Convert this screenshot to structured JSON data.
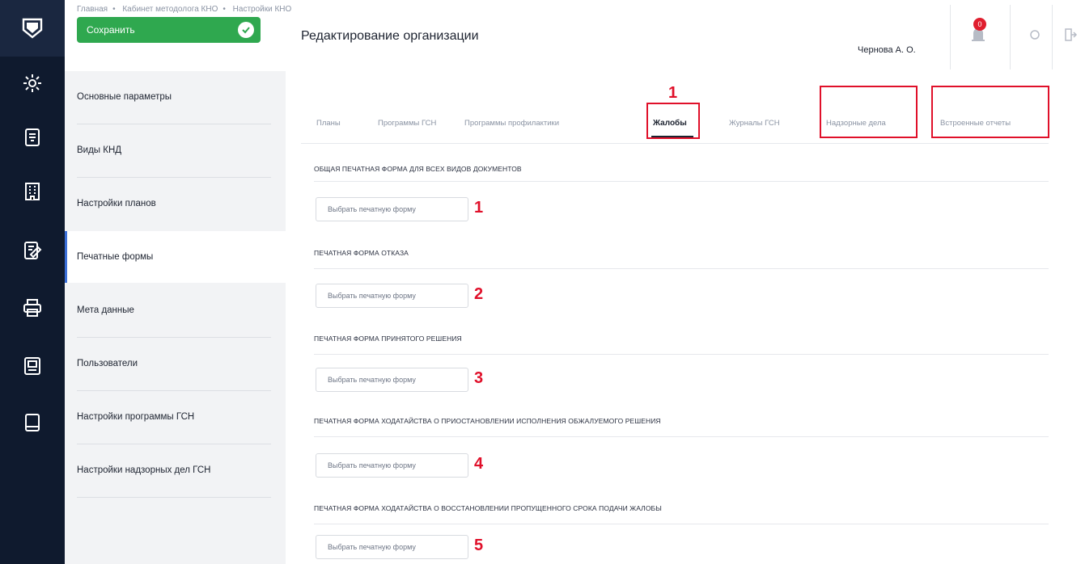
{
  "breadcrumb": [
    "Главная",
    "Кабинет методолога КНО",
    "Настройки КНО"
  ],
  "toolbar": {
    "save_label": "Сохранить"
  },
  "page_title": "Редактирование организации",
  "user": {
    "name": "Чернова А. О."
  },
  "notifications": {
    "count": "0"
  },
  "rail_icons": [
    "logo-icon",
    "gear-icon",
    "document-icon",
    "building-icon",
    "edit-document-icon",
    "printer-icon",
    "report-icon",
    "book-icon"
  ],
  "menu": {
    "items": [
      {
        "label": "Основные параметры"
      },
      {
        "label": "Виды КНД"
      },
      {
        "label": "Настройки планов"
      },
      {
        "label": "Печатные формы"
      },
      {
        "label": "Мета данные"
      },
      {
        "label": "Пользователи"
      },
      {
        "label": "Настройки программы ГСН"
      },
      {
        "label": "Настройки надзорных дел ГСН"
      }
    ],
    "active_index": 3
  },
  "tabs": [
    {
      "label": "Планы"
    },
    {
      "label": "Программы ГСН"
    },
    {
      "label": "Программы профилактики"
    },
    {
      "label": "Жалобы"
    },
    {
      "label": "Журналы ГСН"
    },
    {
      "label": "Надзорные дела"
    },
    {
      "label": "Встроенные отчеты"
    }
  ],
  "active_tab": 3,
  "sections": [
    {
      "title": "ОБЩАЯ ПЕЧАТНАЯ ФОРМА ДЛЯ ВСЕХ ВИДОВ ДОКУМЕНТОВ",
      "button": "Выбрать печатную форму",
      "marker": "1"
    },
    {
      "title": "ПЕЧАТНАЯ ФОРМА ОТКАЗА",
      "button": "Выбрать печатную форму",
      "marker": "2"
    },
    {
      "title": "ПЕЧАТНАЯ ФОРМА ПРИНЯТОГО РЕШЕНИЯ",
      "button": "Выбрать печатную форму",
      "marker": "3"
    },
    {
      "title": "ПЕЧАТНАЯ ФОРМА ХОДАТАЙСТВА О ПРИОСТАНОВЛЕНИИ ИСПОЛНЕНИЯ ОБЖАЛУЕМОГО РЕШЕНИЯ",
      "button": "Выбрать печатную форму",
      "marker": "4"
    },
    {
      "title": "ПЕЧАТНАЯ ФОРМА ХОДАТАЙСТВА О ВОССТАНОВЛЕНИИ ПРОПУЩЕННОГО СРОКА ПОДАЧИ ЖАЛОБЫ",
      "button": "Выбрать печатную форму",
      "marker": "5"
    }
  ],
  "annotations": {
    "tab_marker": "1",
    "highlight_color": "#e0102a"
  },
  "colors": {
    "rail": "#0f1a2e",
    "accent_green": "#2fa84f",
    "active_menu": "#3b6fd8"
  }
}
